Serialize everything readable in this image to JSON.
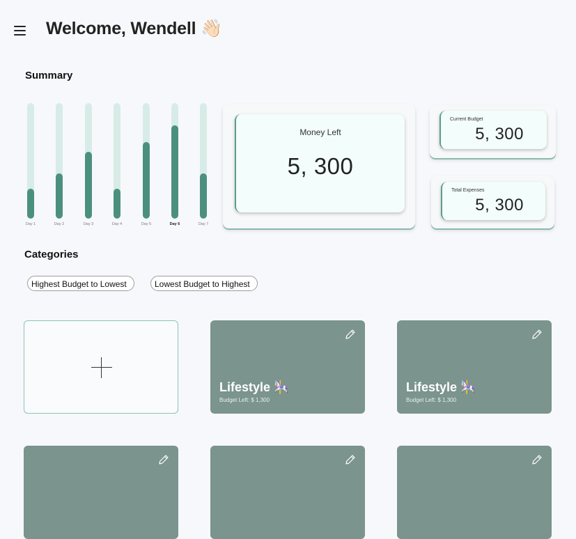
{
  "header": {
    "title": "Welcome, Wendell 👋🏻"
  },
  "summary": {
    "title": "Summary",
    "money_left": {
      "label": "Money Left",
      "value": "5, 300"
    },
    "current_budget": {
      "label": "Current Budget",
      "value": "5, 300"
    },
    "total_expenses": {
      "label": "Total Expenses",
      "value": "5, 300"
    }
  },
  "chart_data": {
    "type": "bar",
    "categories": [
      "Day 1",
      "Day 2",
      "Day 3",
      "Day 4",
      "Day 5",
      "Day 6",
      "Day 7"
    ],
    "values": [
      26,
      39,
      58,
      26,
      66,
      81,
      39
    ],
    "ylim": [
      0,
      100
    ],
    "highlighted": "Day 6",
    "colors": {
      "track": "#d7ece7",
      "fill": "#4b907e"
    }
  },
  "categories": {
    "title": "Categories",
    "sort_options": [
      "Highest Budget to Lowest",
      "Lowest Budget to Highest"
    ],
    "items": [
      {
        "name": "Lifestyle 🎠",
        "budget_left": "Budget Left: $ 1,300"
      },
      {
        "name": "Lifestyle 🎠",
        "budget_left": "Budget Left: $ 1,300"
      }
    ]
  },
  "colors": {
    "accent": "#4b907e",
    "tile": "#7b948d"
  }
}
